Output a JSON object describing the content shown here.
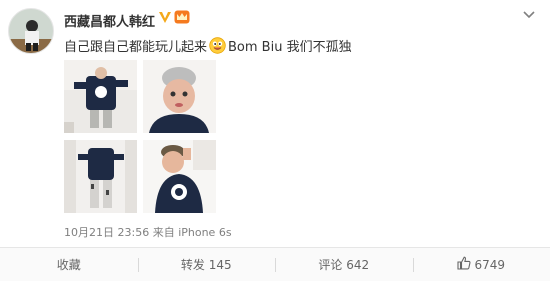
{
  "post": {
    "author": "西藏昌都人韩红",
    "text_part1": "自己跟自己都能玩儿起来",
    "text_part2": "Bom Biu 我们不孤独",
    "timestamp": "10月21日 23:56",
    "source": "来自 iPhone 6s"
  },
  "actions": {
    "favorite": "收藏",
    "repost": "转发 145",
    "comment": "评论 642",
    "like": "6749"
  },
  "colors": {
    "verified": "#f4a91b",
    "divider": "#e6e6e6",
    "action_text": "#666666"
  },
  "icons": [
    "verified-v-icon",
    "vip-crown-icon",
    "chevron-down-icon",
    "laughing-emoji-icon",
    "thumb-up-icon"
  ]
}
